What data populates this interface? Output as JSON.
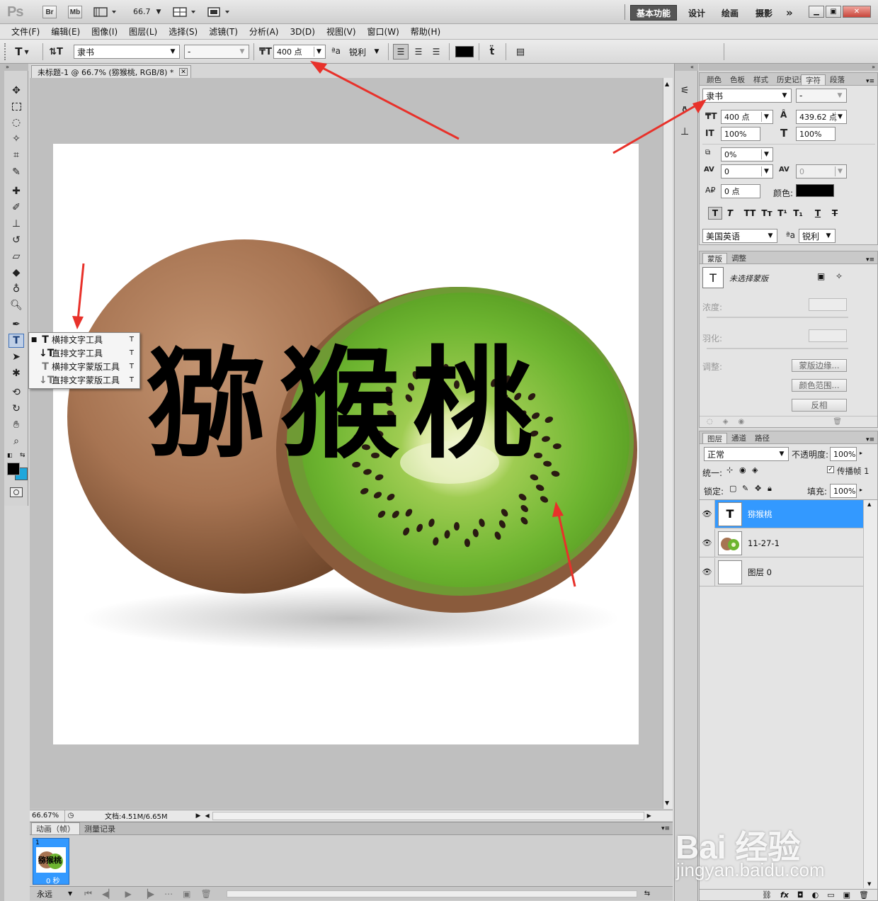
{
  "app": {
    "logo": "Ps",
    "bridge_button": "Br",
    "minibridge_button": "Mb",
    "zoom_value": "66.7",
    "workspaces": [
      "基本功能",
      "设计",
      "绘画",
      "摄影"
    ],
    "overflow": "»"
  },
  "menu": [
    "文件(F)",
    "编辑(E)",
    "图像(I)",
    "图层(L)",
    "选择(S)",
    "滤镜(T)",
    "分析(A)",
    "3D(D)",
    "视图(V)",
    "窗口(W)",
    "帮助(H)"
  ],
  "options": {
    "font_family": "隶书",
    "font_style": "-",
    "font_size": "400 点",
    "aa_label": "ªa",
    "antialias": "锐利"
  },
  "document": {
    "tab_title": "未标题-1 @ 66.7% (猕猴桃, RGB/8) *",
    "canvas_text": "猕猴桃"
  },
  "flyout": {
    "items": [
      {
        "label": "横排文字工具",
        "shortcut": "T"
      },
      {
        "label": "直排文字工具",
        "shortcut": "T"
      },
      {
        "label": "横排文字蒙版工具",
        "shortcut": "T"
      },
      {
        "label": "直排文字蒙版工具",
        "shortcut": "T"
      }
    ]
  },
  "status": {
    "zoom": "66.67%",
    "doc": "文档:4.51M/6.65M"
  },
  "animation": {
    "tabs": [
      "动画（帧）",
      "测量记录"
    ],
    "frame_number": "1",
    "frame_delay": "0 秒",
    "loop": "永远"
  },
  "character_panel": {
    "tabs": [
      "颜色",
      "色板",
      "样式",
      "历史记录",
      "字符",
      "段落"
    ],
    "font_family": "隶书",
    "font_style": "-",
    "font_size": "400 点",
    "leading": "439.62 点",
    "vertical_scale": "100%",
    "horizontal_scale": "100%",
    "tsume": "0%",
    "kerning": "0",
    "tracking": "0",
    "baseline": "0 点",
    "color_label": "颜色:",
    "language": "美国英语",
    "antialias": "锐利"
  },
  "masks_panel": {
    "tabs": [
      "蒙版",
      "调整"
    ],
    "status": "未选择蒙版",
    "density_label": "浓度:",
    "feather_label": "羽化:",
    "refine_label": "调整:",
    "mask_edge": "蒙版边缘...",
    "color_range": "颜色范围...",
    "invert": "反相"
  },
  "layers_panel": {
    "tabs": [
      "图层",
      "通道",
      "路径"
    ],
    "blend_mode": "正常",
    "opacity_label": "不透明度:",
    "opacity": "100%",
    "unify_label": "统一:",
    "propagate_label": "传播帧 1",
    "lock_label": "锁定:",
    "fill_label": "填充:",
    "fill": "100%",
    "layers": [
      {
        "name": "猕猴桃",
        "type": "text",
        "selected": true
      },
      {
        "name": "11-27-1",
        "type": "image",
        "selected": false
      },
      {
        "name": "图层 0",
        "type": "fill",
        "selected": false
      }
    ]
  },
  "watermark": {
    "brand": "Bai 经验",
    "url": "jingyan.baidu.com"
  },
  "colors": {
    "selection": "#3399ff",
    "arrow": "#e8312a",
    "foreground": "#000000",
    "background": "#1ea7dc"
  }
}
